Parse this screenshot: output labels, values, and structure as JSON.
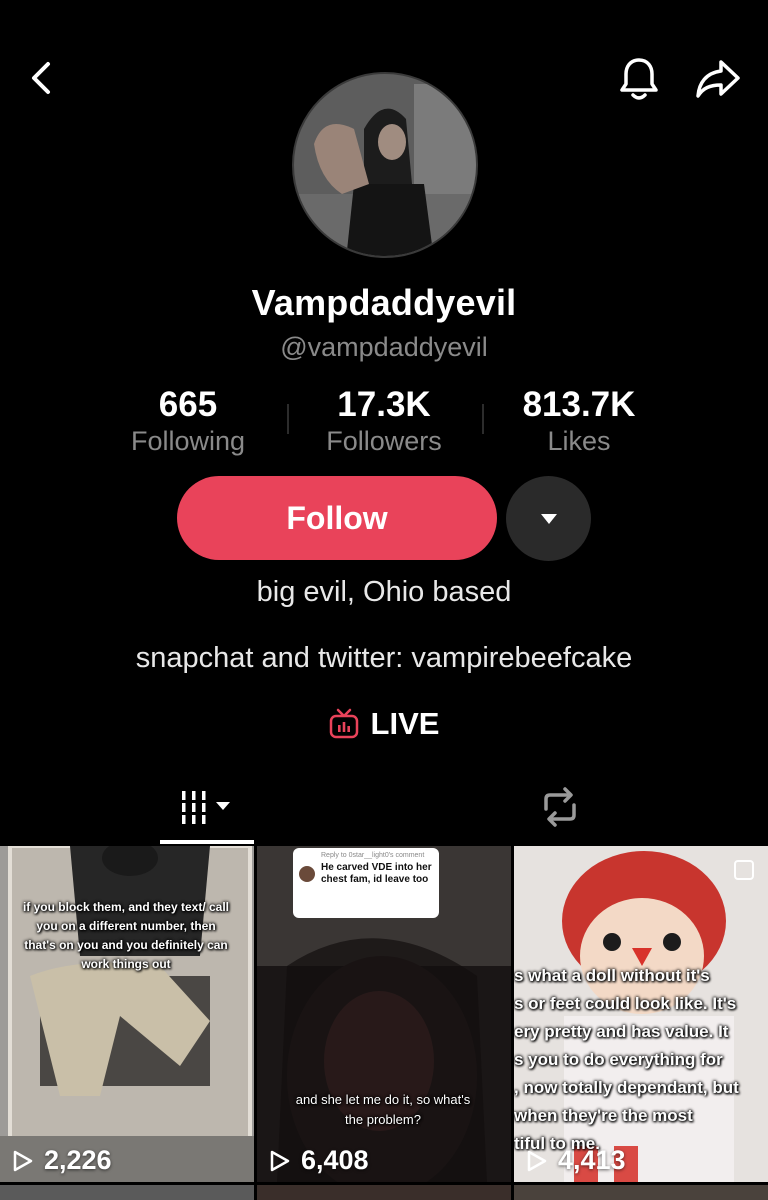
{
  "nav": {
    "back_icon": "chevron-left-icon",
    "bell_icon": "bell-icon",
    "share_icon": "share-arrow-icon"
  },
  "profile": {
    "display_name": "Vampdaddyevil",
    "handle": "@vampdaddyevil",
    "stats": [
      {
        "value": "665",
        "label": "Following"
      },
      {
        "value": "17.3K",
        "label": "Followers"
      },
      {
        "value": "813.7K",
        "label": "Likes"
      }
    ],
    "follow_label": "Follow",
    "bio_lines": [
      "big evil, Ohio based",
      "snapchat and twitter: vampirebeefcake"
    ],
    "live_label": "LIVE"
  },
  "colors": {
    "accent": "#e9435a",
    "live_icon": "#e9435a",
    "muted": "#8a8a8a"
  },
  "tabs": [
    {
      "icon": "videos-grid-icon",
      "active": true
    },
    {
      "icon": "repost-icon",
      "active": false
    }
  ],
  "videos": [
    {
      "views": "2,226",
      "caption": "if you block them, and they text/ call you on a different number, then that's on you and you definitely can work things out"
    },
    {
      "views": "6,408",
      "reply_header": "Reply to 0star__light0's comment",
      "reply_text": "He carved VDE into her chest fam, id leave too",
      "caption": "and she let me do it, so what's the problem?"
    },
    {
      "views": "4,413",
      "caption_lines": [
        "s what a doll without it's",
        "s or feet could look like. It's",
        "ery pretty and has value. It",
        "s you to do everything for",
        ", now totally dependant, but",
        "when they're the most",
        "tiful to me."
      ]
    }
  ]
}
